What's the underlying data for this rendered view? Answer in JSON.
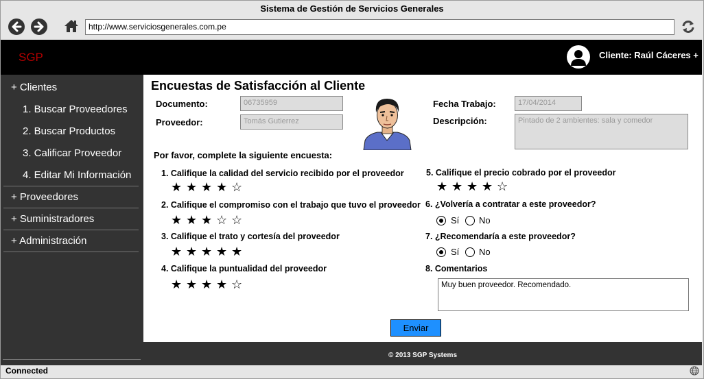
{
  "window": {
    "title": "Sistema de Gestión de Servicios Generales"
  },
  "browser": {
    "url": "http://www.serviciosgenerales.com.pe"
  },
  "header": {
    "logo": "SGP",
    "client": "Cliente: Raúl Cáceres +"
  },
  "sidebar": {
    "items": [
      {
        "label": "+ Clientes"
      },
      {
        "label": "1. Buscar Proveedores"
      },
      {
        "label": "2. Buscar Productos"
      },
      {
        "label": "3. Calificar Proveedor"
      },
      {
        "label": "4. Editar Mi Información"
      },
      {
        "label": "+ Proveedores"
      },
      {
        "label": "+ Suministradores"
      },
      {
        "label": "+ Administración"
      }
    ]
  },
  "main": {
    "title": "Encuestas de Satisfacción al Cliente",
    "documento": {
      "label": "Documento:",
      "value": "06735959"
    },
    "proveedor": {
      "label": "Proveedor:",
      "value": "Tomás Gutierrez"
    },
    "fecha": {
      "label": "Fecha Trabajo:",
      "value": "17/04/2014"
    },
    "descripcion": {
      "label": "Descripción:",
      "value": "Pintado de 2 ambientes: sala y comedor"
    },
    "intro": "Por favor, complete la siguiente encuesta:",
    "questions": [
      {
        "text": "1. Califique la calidad del servicio recibido por el proveedor",
        "rating": 4
      },
      {
        "text": "2. Califique el compromiso con el trabajo que tuvo el proveedor",
        "rating": 3
      },
      {
        "text": "3. Califique el trato y cortesía del proveedor",
        "rating": 5
      },
      {
        "text": "4. Califique la puntualidad del proveedor",
        "rating": 4
      },
      {
        "text": "5. Califique el precio cobrado por el proveedor",
        "rating": 4
      },
      {
        "text": "6.  ¿Volvería a contratar a este proveedor?",
        "answer": "Sí"
      },
      {
        "text": "7.  ¿Recomendaría a este proveedor?",
        "answer": "Sí"
      },
      {
        "text": "8.   Comentarios"
      }
    ],
    "options": {
      "yes": "Sí",
      "no": "No"
    },
    "comments": "Muy buen proveedor. Recomendado.",
    "submit": "Enviar"
  },
  "footer": {
    "text": "© 2013 SGP Systems"
  },
  "status": {
    "text": "Connected"
  }
}
